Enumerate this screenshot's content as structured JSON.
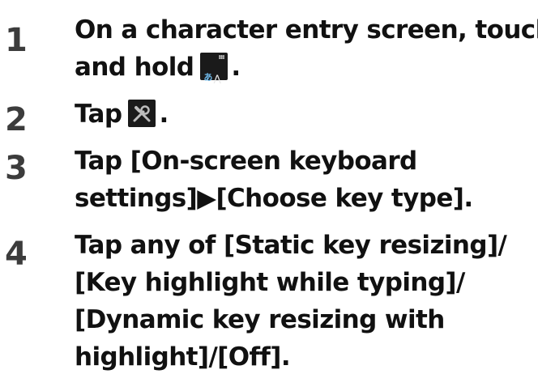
{
  "steps": [
    {
      "number": "1",
      "lines": [
        "On a character entry screen, touch",
        "and hold",
        "."
      ],
      "icon": "japanese-input-mode-icon"
    },
    {
      "number": "2",
      "lines": [
        "Tap",
        "."
      ],
      "icon": "tools-settings-icon"
    },
    {
      "number": "3",
      "lines": [
        "Tap [On-screen keyboard",
        "settings]▶[Choose key type]."
      ]
    },
    {
      "number": "4",
      "lines": [
        "Tap any of [Static key resizing]/",
        "[Key highlight while typing]/",
        "[Dynamic key resizing with",
        "highlight]/[Off]."
      ]
    }
  ],
  "icon_glyphs": {
    "japanese_kana": "あ",
    "latin": "A"
  },
  "colors": {
    "text": "#111111",
    "step_number": "#3c3c3c",
    "icon_background": "#1a1a1a",
    "icon_accent": "#6fb8e8"
  }
}
